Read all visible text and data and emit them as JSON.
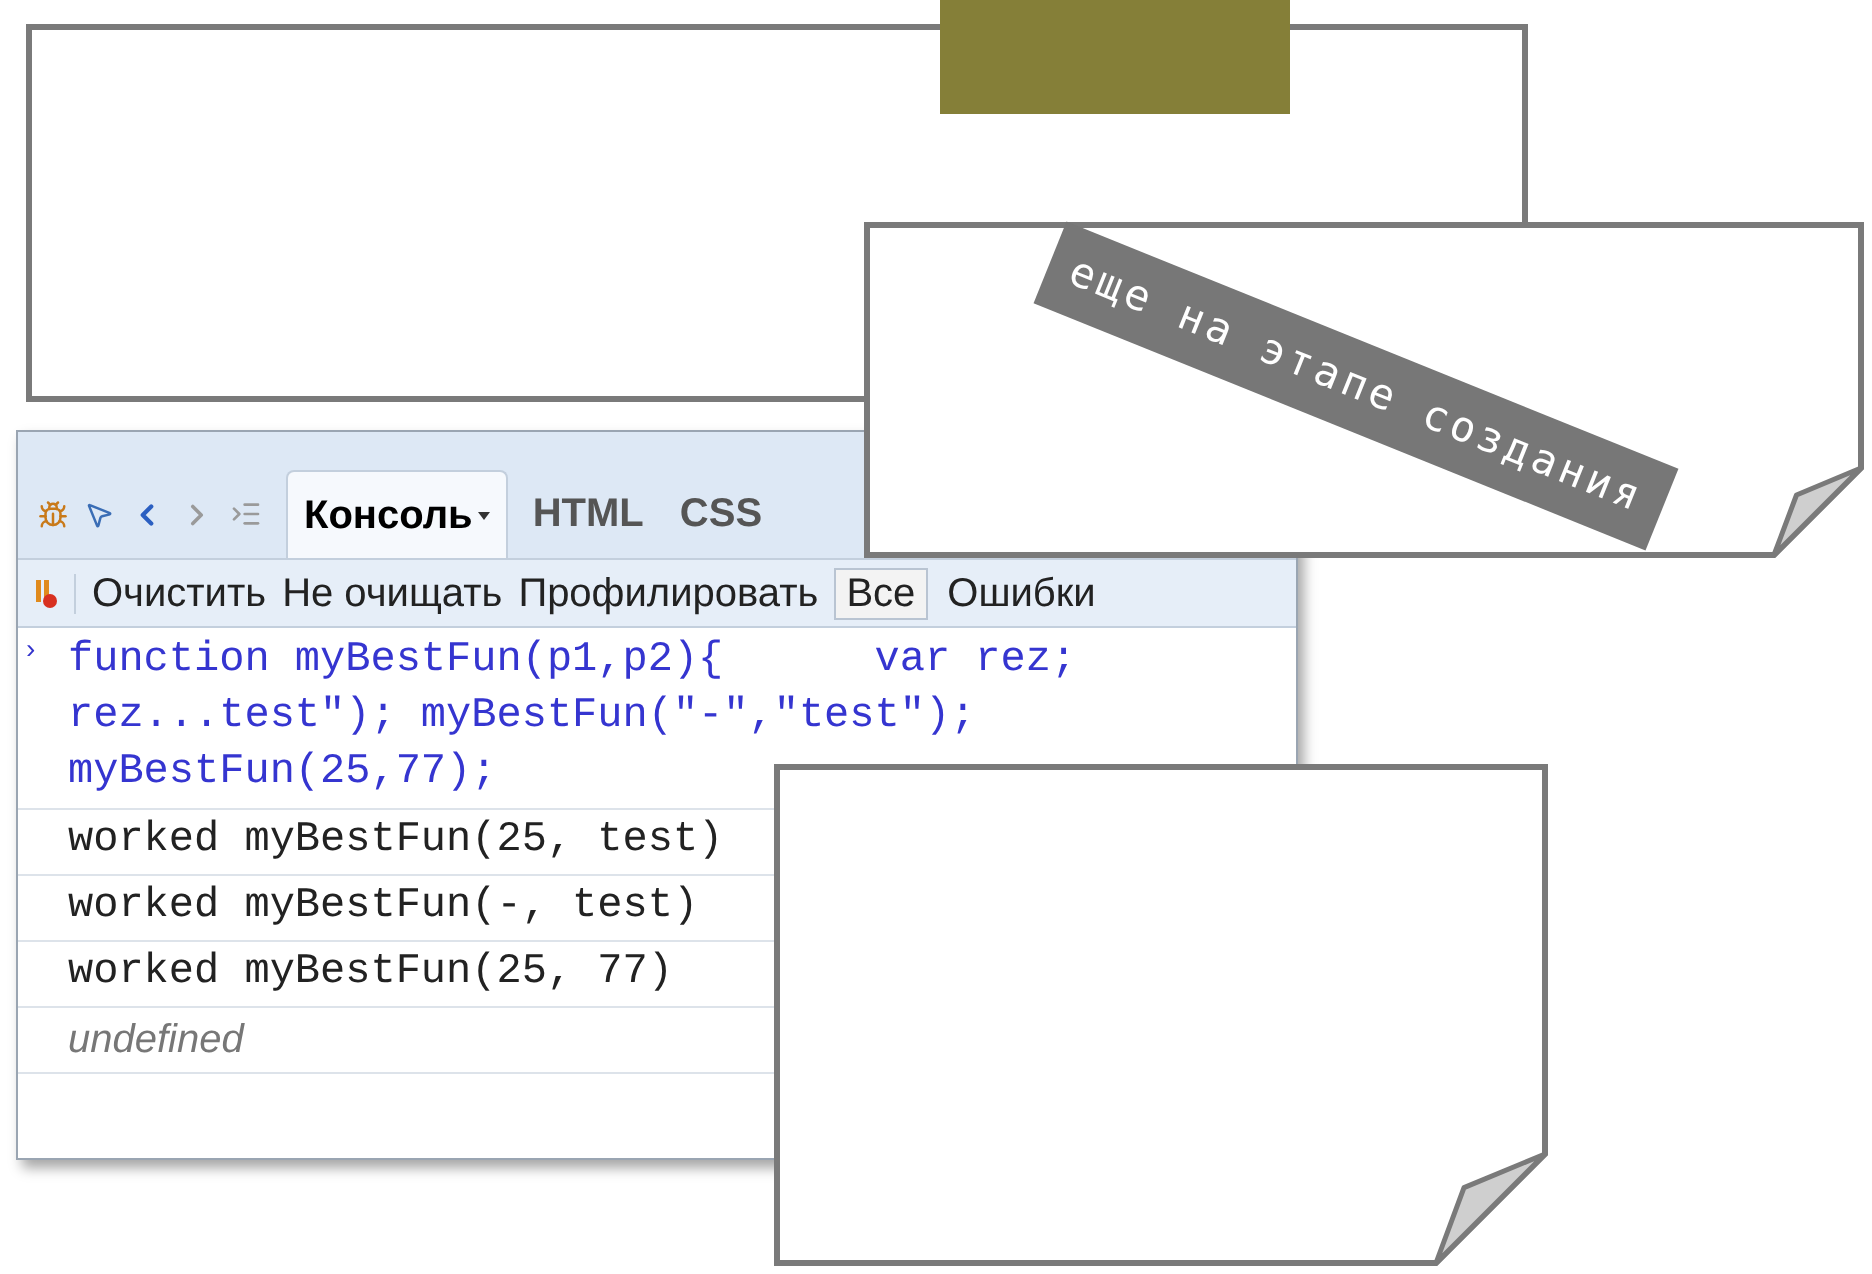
{
  "console": {
    "tabs": [
      {
        "label": "Консоль",
        "selected": true,
        "menu": true
      },
      {
        "label": "HTML",
        "selected": false,
        "menu": false
      },
      {
        "label": "CSS",
        "selected": false,
        "menu": false
      }
    ],
    "toolbar": {
      "buttons": [
        "Очистить",
        "Не очищать",
        "Профилировать"
      ],
      "filters": [
        {
          "label": "Все",
          "selected": true
        },
        {
          "label": "Ошибки",
          "selected": false
        }
      ]
    },
    "prompt": "›",
    "command_lines": [
      "function myBestFun(p1,p2){      var rez;",
      "rez...test\"); myBestFun(\"-\",\"test\");",
      "myBestFun(25,77);"
    ],
    "output": [
      {
        "kind": "log",
        "text": "worked myBestFun(25, test)"
      },
      {
        "kind": "log",
        "text": "worked myBestFun(-, test)"
      },
      {
        "kind": "log",
        "text": "worked myBestFun(25, 77)"
      },
      {
        "kind": "result",
        "text": "undefined"
      }
    ]
  },
  "banner": {
    "text": "еще на этапе создания"
  }
}
